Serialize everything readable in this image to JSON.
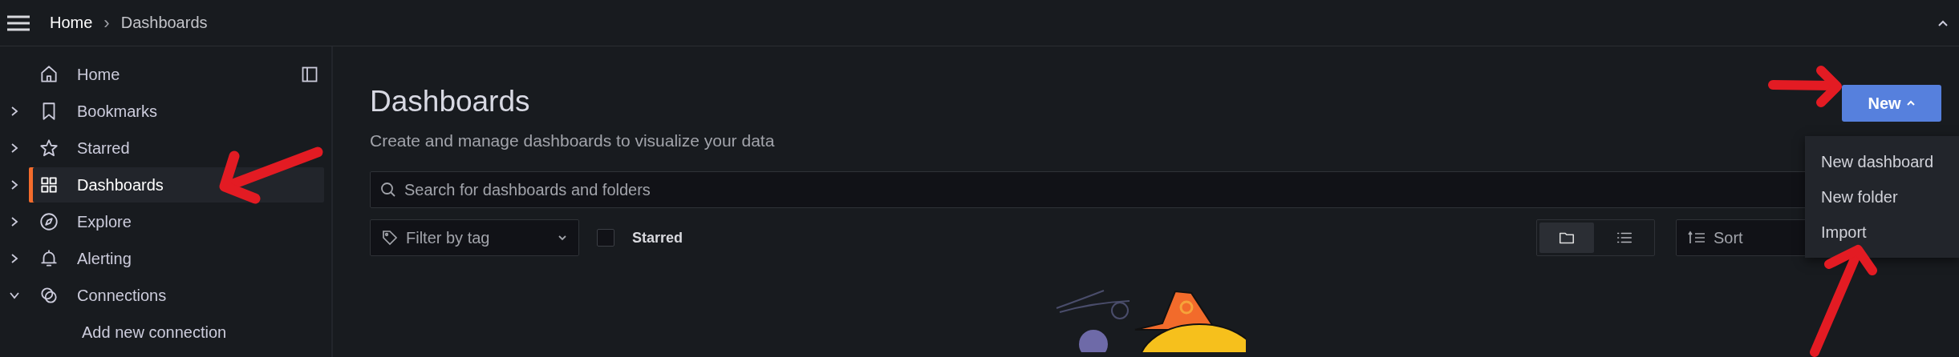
{
  "topbar": {
    "separator": "›",
    "breadcrumbs": [
      {
        "label": "Home",
        "current": false
      },
      {
        "label": "Dashboards",
        "current": true
      }
    ]
  },
  "sidebar": {
    "items": [
      {
        "label": "Home",
        "kind": "home",
        "expandable": false,
        "expanded": false,
        "selected": false
      },
      {
        "label": "Bookmarks",
        "kind": "bookmark",
        "expandable": true,
        "expanded": false,
        "selected": false
      },
      {
        "label": "Starred",
        "kind": "star",
        "expandable": true,
        "expanded": false,
        "selected": false
      },
      {
        "label": "Dashboards",
        "kind": "grid",
        "expandable": true,
        "expanded": false,
        "selected": true
      },
      {
        "label": "Explore",
        "kind": "compass",
        "expandable": true,
        "expanded": false,
        "selected": false
      },
      {
        "label": "Alerting",
        "kind": "bell",
        "expandable": true,
        "expanded": false,
        "selected": false
      },
      {
        "label": "Connections",
        "kind": "link",
        "expandable": true,
        "expanded": true,
        "selected": false,
        "children": [
          {
            "label": "Add new connection",
            "selected": false
          }
        ]
      }
    ]
  },
  "main": {
    "title": "Dashboards",
    "subtitle": "Create and manage dashboards to visualize your data",
    "search": {
      "placeholder": "Search for dashboards and folders"
    },
    "tag_filter": {
      "placeholder": "Filter by tag"
    },
    "starred_filter": {
      "label": "Starred",
      "checked": false
    },
    "view_toggle": [
      {
        "kind": "folder",
        "selected": true
      },
      {
        "kind": "list",
        "selected": false
      }
    ],
    "sort": {
      "placeholder": "Sort"
    },
    "new_button": {
      "label": "New",
      "expanded": true
    },
    "new_menu": [
      {
        "label": "New dashboard"
      },
      {
        "label": "New folder"
      },
      {
        "label": "Import"
      }
    ]
  }
}
